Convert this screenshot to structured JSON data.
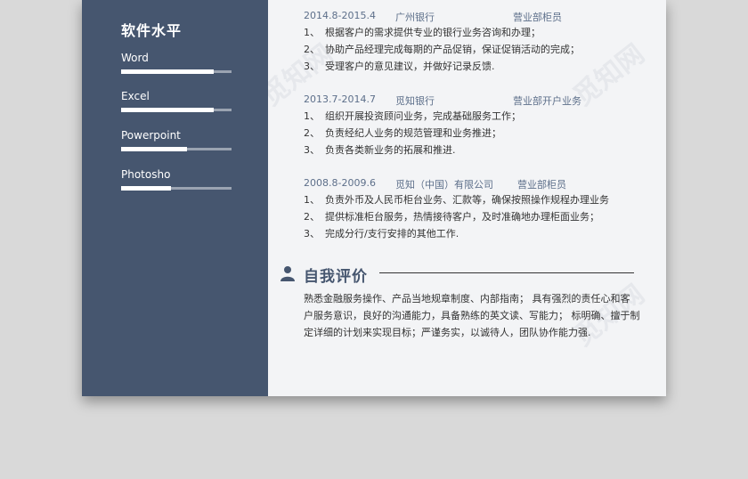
{
  "sidebar": {
    "title": "软件水平",
    "skills": [
      {
        "label": "Word",
        "level": 0.84
      },
      {
        "label": "Excel",
        "level": 0.84
      },
      {
        "label": "Powerpoint",
        "level": 0.6
      },
      {
        "label": "Photosho",
        "level": 0.45
      }
    ]
  },
  "jobs": [
    {
      "date": "2014.8-2015.4",
      "company": "广州银行",
      "position": "营业部柜员",
      "items": [
        {
          "num": "1、",
          "text": "根据客户的需求提供专业的银行业务咨询和办理；"
        },
        {
          "num": "2、",
          "text": "协助产品经理完成每期的产品促销，保证促销活动的完成；"
        },
        {
          "num": "3、",
          "text": "受理客户的意见建议，并做好记录反馈."
        }
      ]
    },
    {
      "date": "2013.7-2014.7",
      "company": "觅知银行",
      "position": "营业部开户业务",
      "items": [
        {
          "num": "1、",
          "text": "组织开展投资顾问业务，完成基础服务工作；"
        },
        {
          "num": "2、",
          "text": "负责经纪人业务的规范管理和业务推进；"
        },
        {
          "num": "3、",
          "text": "负责各类新业务的拓展和推进."
        }
      ]
    },
    {
      "date": "2008.8-2009.6",
      "company": "觅知（中国）有限公司",
      "position": "营业部柜员",
      "items": [
        {
          "num": "1、",
          "text": "负责外币及人民币柜台业务、汇款等，确保按照操作规程办理业务"
        },
        {
          "num": "2、",
          "text": "提供标准柜台服务，热情接待客户，及时准确地办理柜面业务；"
        },
        {
          "num": "3、",
          "text": "完成分行/支行安排的其他工作."
        }
      ]
    }
  ],
  "self_eval": {
    "title": "自我评价",
    "lines": [
      "熟悉金融服务操作、产品当地规章制度、内部指南；  具有强烈的责任心和客",
      "户服务意识，良好的沟通能力，具备熟练的英文读、写能力；  标明确、擅于制",
      "定详细的计划来实现目标；严谨务实，以诚待人，团队协作能力强."
    ]
  },
  "watermark": "觅知网",
  "colors": {
    "sidebar": "#46566f",
    "accent": "#5d6f8a",
    "page": "#f3f4f6"
  }
}
